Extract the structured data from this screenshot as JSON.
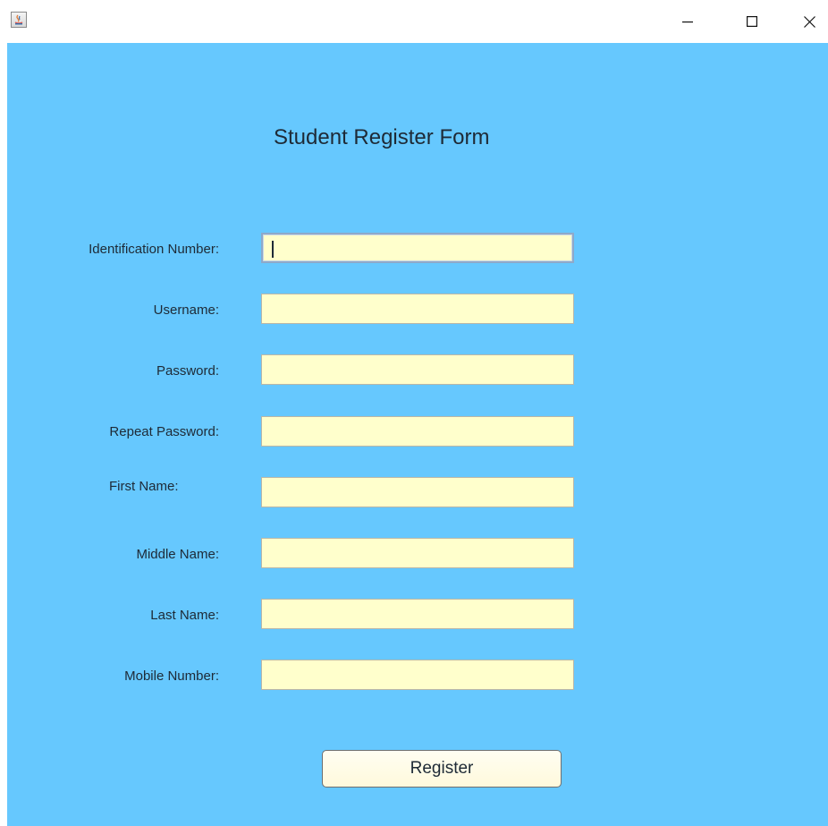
{
  "window": {
    "title": "",
    "controls": {
      "minimize": "—",
      "maximize": "☐",
      "close": "✕"
    }
  },
  "form": {
    "title": "Student Register Form",
    "fields": [
      {
        "label": "Identification Number:",
        "value": "",
        "focused": true
      },
      {
        "label": "Username:",
        "value": ""
      },
      {
        "label": "Password:",
        "value": ""
      },
      {
        "label": "Repeat Password:",
        "value": ""
      },
      {
        "label": "First Name:",
        "value": ""
      },
      {
        "label": "Middle Name:",
        "value": ""
      },
      {
        "label": "Last Name:",
        "value": ""
      },
      {
        "label": "Mobile Number:",
        "value": ""
      }
    ],
    "register_label": "Register"
  },
  "colors": {
    "background": "#66c8fe",
    "input_background": "#ffffcc",
    "button_background": "#fffbe6"
  },
  "icons": {
    "app": "java-app-icon"
  }
}
